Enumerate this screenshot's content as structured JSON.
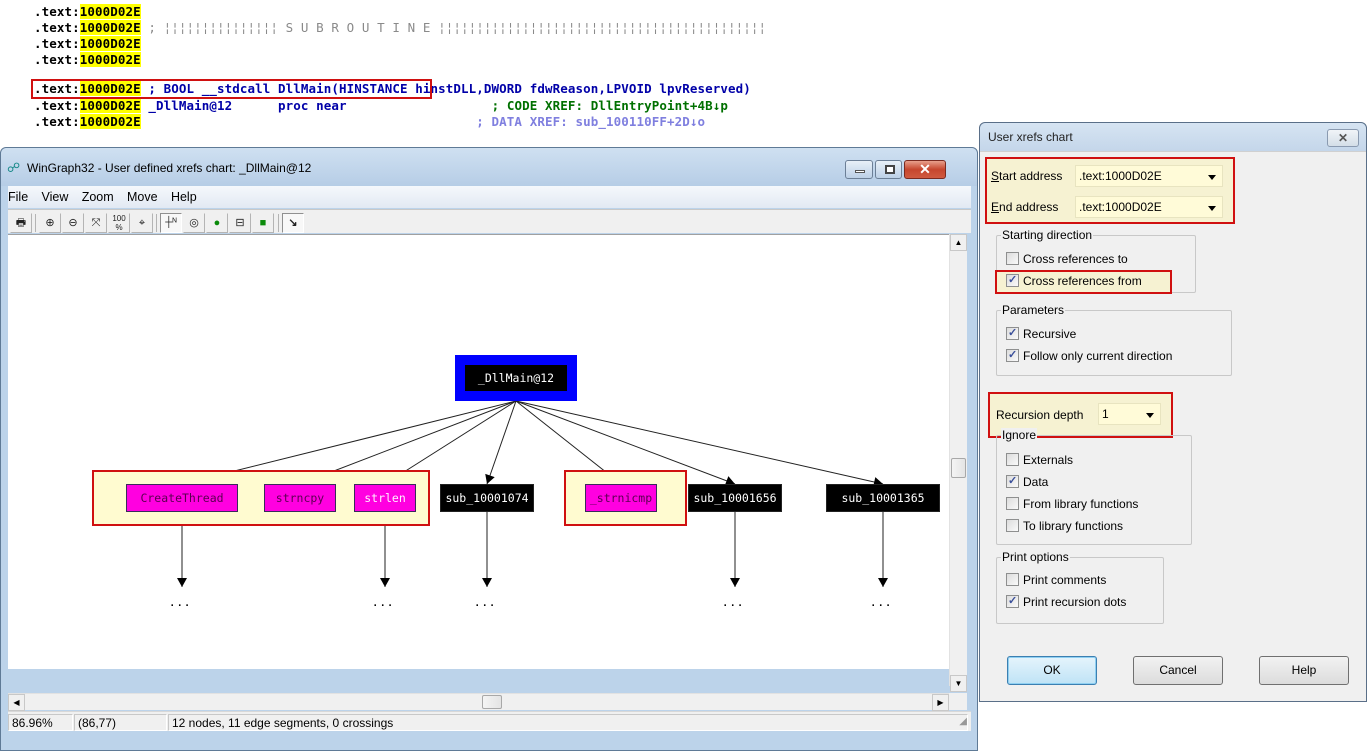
{
  "ida": {
    "lines": [
      {
        "seg": ".text:",
        "addr": "1000D02E",
        "rest": "",
        "style": ""
      },
      {
        "seg": ".text:",
        "addr": "1000D02E",
        "rest": " ; ¦¦¦¦¦¦¦¦¦¦¦¦¦¦¦ S U B R O U T I N E ¦¦¦¦¦¦¦¦¦¦¦¦¦¦¦¦¦¦¦¦¦¦¦¦¦¦¦¦¦¦¦¦¦¦¦¦¦¦¦¦¦¦¦",
        "style": "cmt-gray"
      },
      {
        "seg": ".text:",
        "addr": "1000D02E",
        "rest": "",
        "style": ""
      },
      {
        "seg": ".text:",
        "addr": "1000D02E",
        "rest": "",
        "style": ""
      },
      {
        "seg": ".text:",
        "addr": "1000D02E",
        "rest": " ; BOOL __stdcall DllMain(HINSTANCE hinstDLL,DWORD fdwReason,LPVOID lpvReserved)",
        "style": "blue"
      },
      {
        "seg": ".text:",
        "addr": "1000D02E",
        "rest": " _DllMain@12      proc near",
        "style": "blue",
        "xref": "                   ; CODE XREF: DllEntryPoint+4B↓p",
        "xref_style": "green"
      },
      {
        "seg": ".text:",
        "addr": "1000D02E",
        "rest": "",
        "style": "",
        "xref": "                                            ; DATA XREF: sub_100110FF+2D↓o",
        "xref_style": "lblue"
      }
    ]
  },
  "wingraph": {
    "title": "WinGraph32 - User defined xrefs chart: _DllMain@12",
    "menu": [
      "File",
      "View",
      "Zoom",
      "Move",
      "Help"
    ],
    "toolbar": [
      {
        "name": "print-icon",
        "glyph": "🖶"
      },
      {
        "name": "zoom-in-icon",
        "glyph": "⊕"
      },
      {
        "name": "zoom-out-icon",
        "glyph": "⊖"
      },
      {
        "name": "fit-window-icon",
        "glyph": "⤧"
      },
      {
        "name": "zoom-100-icon",
        "glyph": "100"
      },
      {
        "name": "center-icon",
        "glyph": "⌖"
      },
      {
        "name": "north-icon",
        "glyph": "┼ᴺ"
      },
      {
        "name": "fisheye-icon",
        "glyph": "◎"
      },
      {
        "name": "fisheye-fixed-icon",
        "glyph": "●"
      },
      {
        "name": "polar-fisheye-icon",
        "glyph": "⊟"
      },
      {
        "name": "polar-fisheye-fixed-icon",
        "glyph": "■"
      },
      {
        "name": "follow-edge-icon",
        "glyph": "↘"
      }
    ],
    "graph": {
      "root": "_DllMain@12",
      "children": [
        {
          "label": "CreateThread",
          "kind": "magenta",
          "recursion_dots": true
        },
        {
          "label": "strncpy",
          "kind": "magenta",
          "recursion_dots": false
        },
        {
          "label": "strlen",
          "kind": "magenta",
          "recursion_dots": true
        },
        {
          "label": "sub_10001074",
          "kind": "black",
          "recursion_dots": true
        },
        {
          "label": "_strnicmp",
          "kind": "magenta",
          "recursion_dots": false
        },
        {
          "label": "sub_10001656",
          "kind": "black",
          "recursion_dots": true
        },
        {
          "label": "sub_10001365",
          "kind": "black",
          "recursion_dots": true
        }
      ],
      "dots": "..."
    },
    "status": {
      "zoom": "86.96%",
      "coords": "(86,77)",
      "summary": "12 nodes, 11 edge segments, 0 crossings"
    }
  },
  "dialog": {
    "title": "User xrefs chart",
    "start_address_label": "Start address",
    "start_address_value": ".text:1000D02E",
    "end_address_label": "End address",
    "end_address_value": ".text:1000D02E",
    "starting_direction": {
      "title": "Starting direction",
      "options": [
        {
          "label": "Cross references to",
          "checked": false
        },
        {
          "label": "Cross references from",
          "checked": true
        }
      ]
    },
    "parameters": {
      "title": "Parameters",
      "options": [
        {
          "label": "Recursive",
          "checked": true
        },
        {
          "label": "Follow only current direction",
          "checked": true
        }
      ]
    },
    "recursion_depth_label": "Recursion depth",
    "recursion_depth_value": "1",
    "ignore": {
      "title": "Ignore",
      "options": [
        {
          "label": "Externals",
          "checked": false
        },
        {
          "label": "Data",
          "checked": true
        },
        {
          "label": "From library functions",
          "checked": false
        },
        {
          "label": "To library functions",
          "checked": false
        }
      ]
    },
    "print_options": {
      "title": "Print options",
      "options": [
        {
          "label": "Print comments",
          "checked": false
        },
        {
          "label": "Print recursion dots",
          "checked": true
        }
      ]
    },
    "buttons": {
      "ok": "OK",
      "cancel": "Cancel",
      "help": "Help"
    }
  }
}
